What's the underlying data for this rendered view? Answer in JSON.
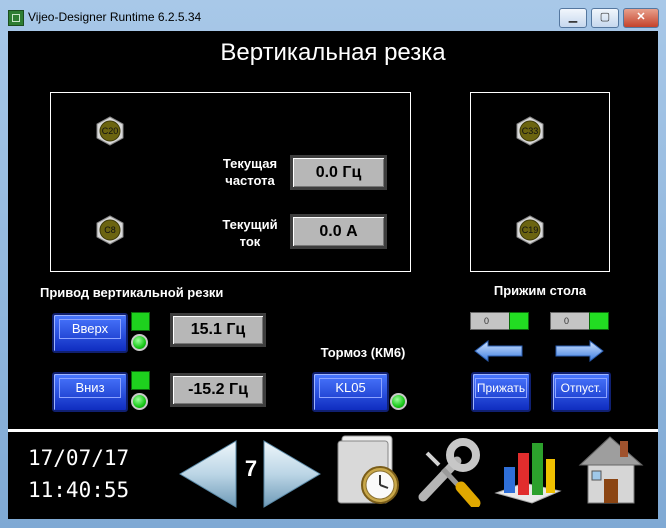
{
  "window": {
    "title": "Vijeo-Designer Runtime 6.2.5.34",
    "controls": {
      "minimize": "▁",
      "maximize": "▢",
      "close": "✕"
    }
  },
  "screen": {
    "heading": "Вертикальная резка",
    "drive_panel": {
      "bolts": [
        "C20",
        "C8"
      ],
      "freq_label": "Текущая\nчастота",
      "freq_value": "0.0 Гц",
      "current_label": "Текущий\nток",
      "current_value": "0.0 А"
    },
    "table_panel": {
      "bolts": [
        "C33",
        "C19"
      ]
    },
    "drive_section": {
      "title": "Привод вертикальной резки",
      "up_button": "Вверх",
      "up_value": "15.1 Гц",
      "down_button": "Вниз",
      "down_value": "-15.2 Гц"
    },
    "brake": {
      "title": "Тормоз (КМ6)",
      "button": "KL05"
    },
    "clamp": {
      "title": "Прижим стола",
      "counter_left": "0",
      "counter_right": "0",
      "press_button": "Прижать",
      "release_button": "Отпуст."
    },
    "footer": {
      "date": "17/07/17",
      "time": "11:40:55",
      "page_number": "7"
    }
  },
  "colors": {
    "background": "#000000",
    "button_blue": "#1a3fe0",
    "indicator_green": "#1ed11e",
    "display_gray": "#b7b7b7",
    "bolt_olive": "#6b6410"
  },
  "icons": [
    "prev-page-arrow-icon",
    "next-page-arrow-icon",
    "clock-folder-icon",
    "tools-icon",
    "bar-chart-icon",
    "home-icon"
  ]
}
